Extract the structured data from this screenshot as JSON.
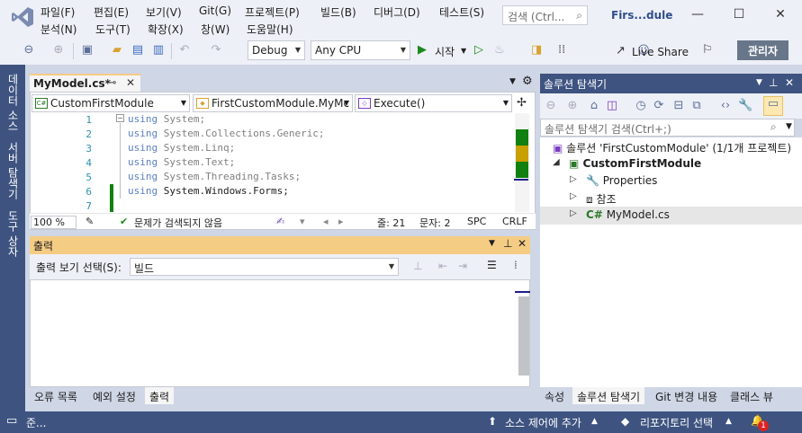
{
  "menu": [
    {
      "id": "file",
      "label": "파일(F)"
    },
    {
      "id": "edit",
      "label": "편집(E)"
    },
    {
      "id": "view",
      "label": "보기(V)"
    },
    {
      "id": "git",
      "label": "Git(G)"
    },
    {
      "id": "project",
      "label": "프로젝트(P)"
    },
    {
      "id": "build",
      "label": "빌드(B)"
    },
    {
      "id": "debug",
      "label": "디버그(D)"
    },
    {
      "id": "test",
      "label": "테스트(S)"
    },
    {
      "id": "analyze",
      "label": "분석(N)"
    },
    {
      "id": "tools",
      "label": "도구(T)"
    },
    {
      "id": "extensions",
      "label": "확장(X)"
    },
    {
      "id": "window",
      "label": "창(W)"
    },
    {
      "id": "help",
      "label": "도움말(H)"
    }
  ],
  "search": {
    "placeholder": "검색 (Ctrl..."
  },
  "solution_title": "Firs...dule",
  "toolbar": {
    "config": "Debug",
    "platform": "Any CPU",
    "start": "시작",
    "live_share": "Live Share",
    "admin": "관리자"
  },
  "side_tabs": [
    "데이터 소스",
    "서버 탐색기",
    "도구 상자"
  ],
  "editor": {
    "tab_label": "MyModel.cs*",
    "nav_project": "CustomFirstModule",
    "nav_class": "FirstCustomModule.MyMc",
    "nav_member": "Execute()",
    "lines": [
      {
        "num": "1",
        "kw": "using",
        "rest": " System;"
      },
      {
        "num": "2",
        "kw": "using",
        "rest": " System.Collections.Generic;"
      },
      {
        "num": "3",
        "kw": "using",
        "rest": " System.Linq;"
      },
      {
        "num": "4",
        "kw": "using",
        "rest": " System.Text;"
      },
      {
        "num": "5",
        "kw": "using",
        "rest": " System.Threading.Tasks;"
      },
      {
        "num": "6",
        "kw": "using",
        "rest": " System.Windows.Forms;"
      },
      {
        "num": "7",
        "kw": "",
        "rest": ""
      }
    ],
    "status": {
      "zoom": "100 %",
      "issues": "문제가 검색되지 않음",
      "line": "줄: 21",
      "col": "문자: 2",
      "spc": "SPC",
      "crlf": "CRLF"
    }
  },
  "output": {
    "title": "출력",
    "show_label": "출력 보기 선택(S):",
    "source": "빌드"
  },
  "bottom_tabs": [
    {
      "label": "오류 목록",
      "active": false
    },
    {
      "label": "예외 설정",
      "active": false
    },
    {
      "label": "출력",
      "active": true
    }
  ],
  "solution_explorer": {
    "title": "솔루션 탐색기",
    "search_placeholder": "솔루션 탐색기 검색(Ctrl+;)",
    "solution": "솔루션 'FirstCustomModule' (1/1개 프로젝트)",
    "project": "CustomFirstModule",
    "items": [
      "Properties",
      "참조",
      "MyModel.cs"
    ],
    "csharp_prefix": "C#"
  },
  "solution_tabs": [
    {
      "label": "속성",
      "active": false
    },
    {
      "label": "솔루션 탐색기",
      "active": true
    },
    {
      "label": "Git 변경 내용",
      "active": false
    },
    {
      "label": "클래스 뷰",
      "active": false
    }
  ],
  "statusbar": {
    "ready": "준...",
    "add_source_control": "소스 제어에 추가",
    "select_repo": "리포지토리 선택",
    "notifications": "1"
  },
  "colors": {
    "accent": "#3e5380",
    "active_tab": "#f5cc84",
    "keyword": "#5a7fbf",
    "line_number": "#2b91af"
  }
}
